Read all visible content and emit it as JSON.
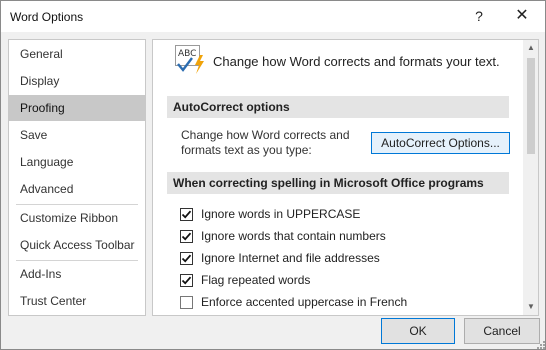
{
  "window": {
    "title": "Word Options",
    "help_label": "?",
    "close_label": "✕"
  },
  "nav": {
    "items": [
      {
        "label": "General"
      },
      {
        "label": "Display"
      },
      {
        "label": "Proofing",
        "selected": true
      },
      {
        "label": "Save"
      },
      {
        "label": "Language"
      },
      {
        "label": "Advanced"
      },
      {
        "label": "Customize Ribbon"
      },
      {
        "label": "Quick Access Toolbar"
      },
      {
        "label": "Add-Ins"
      },
      {
        "label": "Trust Center"
      }
    ]
  },
  "main": {
    "header_icon": "abc-spellcheck-icon",
    "header_icon_text": "ABC",
    "header_text": "Change how Word corrects and formats your text.",
    "autocorrect": {
      "section_title": "AutoCorrect options",
      "description": "Change how Word corrects and formats text as you type:",
      "button_label": "AutoCorrect Options..."
    },
    "spelling": {
      "section_title": "When correcting spelling in Microsoft Office programs",
      "options": [
        {
          "label": "Ignore words in UPPERCASE",
          "checked": true
        },
        {
          "label": "Ignore words that contain numbers",
          "checked": true
        },
        {
          "label": "Ignore Internet and file addresses",
          "checked": true
        },
        {
          "label": "Flag repeated words",
          "checked": true
        },
        {
          "label": "Enforce accented uppercase in French",
          "checked": false
        }
      ]
    }
  },
  "buttons": {
    "ok": "OK",
    "cancel": "Cancel"
  },
  "colors": {
    "accent": "#0078d7",
    "selected_nav": "#c8c8c8",
    "section_bar": "#e4e4e4",
    "icon_check": "#2b6cb0",
    "icon_bolt": "#f0a30a"
  }
}
